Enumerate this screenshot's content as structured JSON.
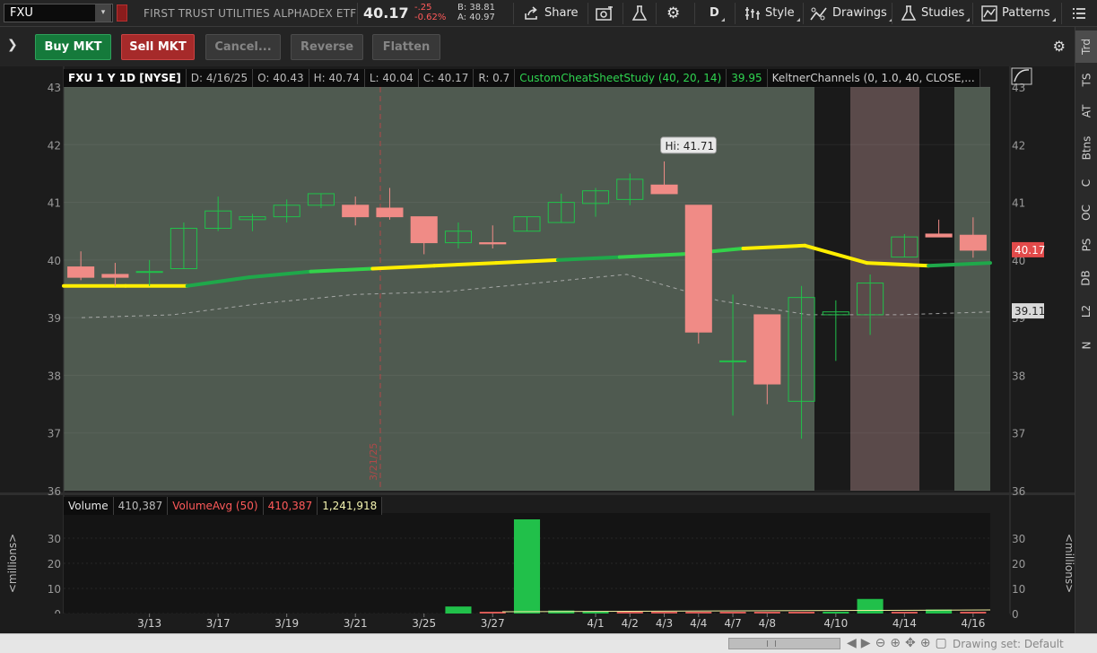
{
  "toolbar": {
    "symbol": "FXU",
    "description": "FIRST TRUST UTILITIES ALPHADEX ETF",
    "last": "40.17",
    "net_change": "-.25",
    "pct_change": "-0.62%",
    "bid": "B: 38.81",
    "ask": "A: 40.97",
    "share": "Share",
    "aggregation": "D",
    "style": "Style",
    "drawings": "Drawings",
    "studies": "Studies",
    "patterns": "Patterns"
  },
  "right_tabs": [
    "Trd",
    "TS",
    "AT",
    "Btns",
    "C",
    "OC",
    "PS",
    "DB",
    "L2",
    "N"
  ],
  "orderbar": {
    "buy": "Buy MKT",
    "sell": "Sell MKT",
    "cancel": "Cancel...",
    "reverse": "Reverse",
    "flatten": "Flatten"
  },
  "price_header": {
    "title": "FXU 1 Y 1D [NYSE]",
    "date": "D: 4/16/25",
    "open": "O: 40.43",
    "high": "H: 40.74",
    "low": "L: 40.04",
    "close": "C: 40.17",
    "range": "R: 0.7",
    "study": "CustomCheatSheetStudy (40, 20, 14)",
    "study_value": "39.95",
    "keltner": "KeltnerChannels (0, 1.0, 40, CLOSE,..."
  },
  "volume_header": {
    "label": "Volume",
    "value": "410,387",
    "avg_label": "VolumeAvg (50)",
    "avg_value": "410,387",
    "avg_value2": "1,241,918"
  },
  "volume_axis_label": "<millions>",
  "status": {
    "drawing_set": "Drawing set: Default"
  },
  "colors": {
    "up": "#21c04a",
    "down": "#f08b86",
    "ma_yellow": "#ffee00",
    "ma_green": "#1fa84a",
    "price_bg": "#4f5a50",
    "dark_bg": "#1a1a1a",
    "pink_bg": "#5a4a4a",
    "last_label": "#e24a4a"
  },
  "chart_data": {
    "type": "candlestick",
    "title": "FXU 1 Y 1D [NYSE]",
    "y_axis": {
      "ticks": [
        36,
        37,
        38,
        39,
        40,
        41,
        42,
        43
      ],
      "range": [
        36,
        43
      ]
    },
    "x_ticks": [
      "3/13",
      "3/17",
      "3/19",
      "3/21",
      "3/25",
      "3/27",
      "4/1",
      "4/2",
      "4/3",
      "4/4",
      "4/7",
      "4/8",
      "4/10",
      "4/14",
      "4/16"
    ],
    "vertical_marker_label": "3/21/25",
    "high_label": "Hi: 41.71",
    "last_price_label": "40.17",
    "keltner_label": "39.11",
    "candles": [
      {
        "date": "3/12",
        "o": 39.88,
        "h": 40.15,
        "l": 39.65,
        "c": 39.7
      },
      {
        "date": "3/13",
        "o": 39.75,
        "h": 39.95,
        "l": 39.55,
        "c": 39.7
      },
      {
        "date": "3/14",
        "o": 39.8,
        "h": 40.0,
        "l": 39.55,
        "c": 39.8
      },
      {
        "date": "3/17",
        "o": 39.85,
        "h": 40.65,
        "l": 39.85,
        "c": 40.55
      },
      {
        "date": "3/18",
        "o": 40.55,
        "h": 41.1,
        "l": 40.5,
        "c": 40.85
      },
      {
        "date": "3/19",
        "o": 40.7,
        "h": 40.8,
        "l": 40.5,
        "c": 40.75
      },
      {
        "date": "3/20",
        "o": 40.75,
        "h": 41.05,
        "l": 40.65,
        "c": 40.95
      },
      {
        "date": "3/21",
        "o": 40.95,
        "h": 41.15,
        "l": 40.9,
        "c": 41.15
      },
      {
        "date": "3/24",
        "o": 40.95,
        "h": 41.1,
        "l": 40.6,
        "c": 40.75
      },
      {
        "date": "3/25",
        "o": 40.9,
        "h": 41.25,
        "l": 40.7,
        "c": 40.75
      },
      {
        "date": "3/26",
        "o": 40.75,
        "h": 40.75,
        "l": 40.1,
        "c": 40.3
      },
      {
        "date": "3/27",
        "o": 40.3,
        "h": 40.65,
        "l": 40.2,
        "c": 40.5
      },
      {
        "date": "3/28",
        "o": 40.3,
        "h": 40.6,
        "l": 40.2,
        "c": 40.28
      },
      {
        "date": "3/31",
        "o": 40.5,
        "h": 40.75,
        "l": 40.5,
        "c": 40.75
      },
      {
        "date": "4/1",
        "o": 40.65,
        "h": 41.15,
        "l": 40.65,
        "c": 41.0
      },
      {
        "date": "4/2",
        "o": 40.98,
        "h": 41.25,
        "l": 40.75,
        "c": 41.2
      },
      {
        "date": "4/3",
        "o": 41.05,
        "h": 41.5,
        "l": 40.95,
        "c": 41.4
      },
      {
        "date": "4/4",
        "o": 41.3,
        "h": 41.71,
        "l": 41.15,
        "c": 41.15
      },
      {
        "date": "4/7",
        "o": 40.95,
        "h": 40.95,
        "l": 38.55,
        "c": 38.75
      },
      {
        "date": "4/8",
        "o": 38.25,
        "h": 39.4,
        "l": 37.3,
        "c": 38.25
      },
      {
        "date": "4/9",
        "o": 39.05,
        "h": 39.05,
        "l": 37.5,
        "c": 37.85
      },
      {
        "date": "4/10",
        "o": 37.55,
        "h": 39.55,
        "l": 36.9,
        "c": 39.35
      },
      {
        "date": "4/11",
        "o": 39.05,
        "h": 39.3,
        "l": 38.25,
        "c": 39.1
      },
      {
        "date": "4/14",
        "o": 39.05,
        "h": 39.75,
        "l": 38.7,
        "c": 39.6
      },
      {
        "date": "4/15",
        "o": 40.05,
        "h": 40.45,
        "l": 40.05,
        "c": 40.4
      },
      {
        "date": "4/16",
        "o": 40.45,
        "h": 40.7,
        "l": 40.4,
        "c": 40.4
      },
      {
        "date": "4/17",
        "o": 40.43,
        "h": 40.74,
        "l": 40.04,
        "c": 40.17
      }
    ],
    "ma_points": [
      39.55,
      39.55,
      39.55,
      39.7,
      39.8,
      39.85,
      39.9,
      39.95,
      40.0,
      40.05,
      40.1,
      40.2,
      40.25,
      39.95,
      39.9,
      39.95
    ],
    "keltner_points": [
      39.0,
      39.05,
      39.25,
      39.4,
      39.45,
      39.6,
      39.75,
      39.3,
      39.05,
      39.05,
      39.1
    ],
    "volume": {
      "y_ticks": [
        0,
        10,
        20,
        30
      ],
      "bars": [
        {
          "date": "3/26",
          "v": 2.8,
          "up": true
        },
        {
          "date": "3/27",
          "v": 0.4,
          "up": false
        },
        {
          "date": "3/28",
          "v": 37.5,
          "up": true
        },
        {
          "date": "3/31",
          "v": 1.2,
          "up": true
        },
        {
          "date": "4/1",
          "v": 0.5,
          "up": true
        },
        {
          "date": "4/2",
          "v": 0.3,
          "up": false
        },
        {
          "date": "4/3",
          "v": 0.3,
          "up": false
        },
        {
          "date": "4/4",
          "v": 0.4,
          "up": false
        },
        {
          "date": "4/7",
          "v": 0.3,
          "up": false
        },
        {
          "date": "4/8",
          "v": 0.4,
          "up": false
        },
        {
          "date": "4/9",
          "v": 0.3,
          "up": false
        },
        {
          "date": "4/10",
          "v": 0.3,
          "up": true
        },
        {
          "date": "4/11",
          "v": 5.8,
          "up": true
        },
        {
          "date": "4/14",
          "v": 0.4,
          "up": false
        },
        {
          "date": "4/15",
          "v": 1.6,
          "up": true
        },
        {
          "date": "4/16",
          "v": 0.4,
          "up": false
        }
      ]
    }
  }
}
